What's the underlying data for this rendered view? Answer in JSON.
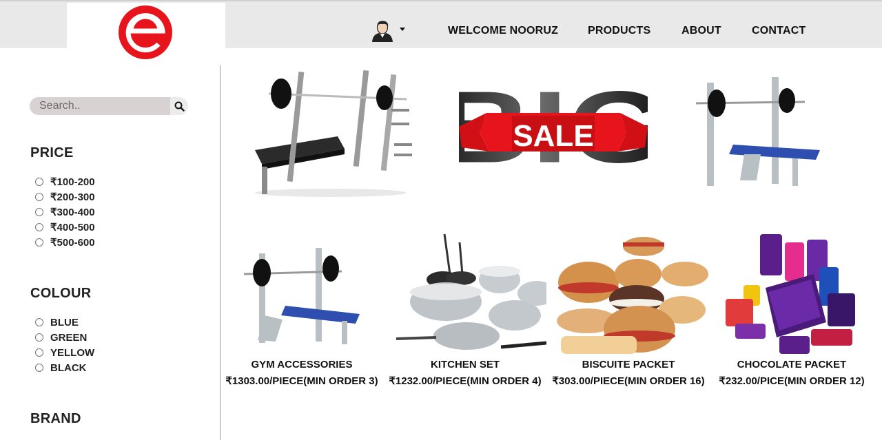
{
  "header": {
    "welcome": "WELCOME NOORUZ",
    "nav": [
      "PRODUCTS",
      "ABOUT",
      "CONTACT"
    ],
    "user_icon": "user-avatar-icon",
    "brand_color": "#e8141b"
  },
  "sidebar": {
    "search_placeholder": "Search..",
    "price_title": "PRICE",
    "price_options": [
      "₹100-200",
      "₹200-300",
      "₹300-400",
      "₹400-500",
      "₹500-600"
    ],
    "colour_title": "COLOUR",
    "colour_options": [
      "BLUE",
      "GREEN",
      "YELLOW",
      "BLACK"
    ],
    "brand_title": "BRAND"
  },
  "banner": {
    "big_text": "BIG",
    "sale_text": "SALE"
  },
  "products": [
    {
      "name": "GYM ACCESSORIES",
      "price": "₹1303.00/PIECE(MIN ORDER 3)"
    },
    {
      "name": "KITCHEN SET",
      "price": "₹1232.00/PIECE(MIN ORDER 4)"
    },
    {
      "name": "BISCUITE PACKET",
      "price": "₹303.00/PIECE(MIN ORDER 16)"
    },
    {
      "name": "CHOCOLATE PACKET",
      "price": "₹232.00/PICE(MIN ORDER 12)"
    }
  ]
}
